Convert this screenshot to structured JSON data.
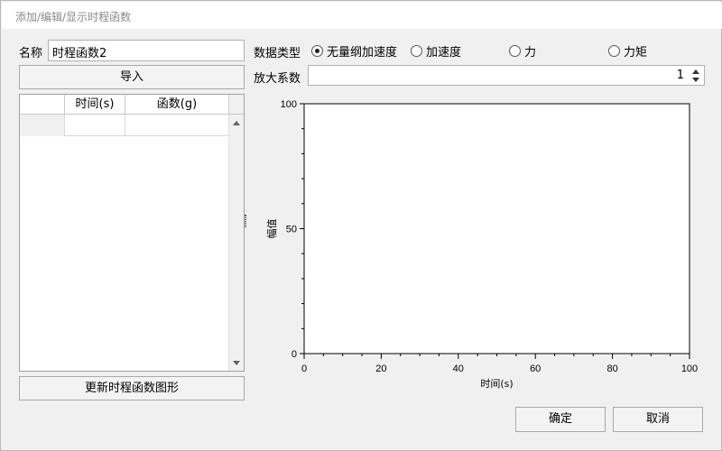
{
  "window": {
    "title": "添加/编辑/显示时程函数"
  },
  "form": {
    "name_label": "名称",
    "name_value": "时程函数2",
    "import_button": "导入",
    "update_button": "更新时程函数图形"
  },
  "table": {
    "columns": [
      "时间(s)",
      "函数(g)"
    ],
    "rows": [
      [
        "",
        ""
      ]
    ]
  },
  "data_type": {
    "label": "数据类型",
    "options": [
      {
        "label": "无量纲加速度",
        "selected": true
      },
      {
        "label": "加速度",
        "selected": false
      },
      {
        "label": "力",
        "selected": false
      },
      {
        "label": "力矩",
        "selected": false
      }
    ]
  },
  "scale": {
    "label": "放大系数",
    "value": "1"
  },
  "chart_data": {
    "type": "line",
    "xlabel": "时间(s)",
    "ylabel": "幅值",
    "xlim": [
      0,
      100
    ],
    "ylim": [
      0,
      100
    ],
    "xticks": [
      "0",
      "20",
      "40",
      "60",
      "80",
      "100"
    ],
    "yticks": [
      "0",
      "50",
      "100"
    ],
    "series": []
  },
  "buttons": {
    "ok": "确定",
    "cancel": "取消"
  }
}
